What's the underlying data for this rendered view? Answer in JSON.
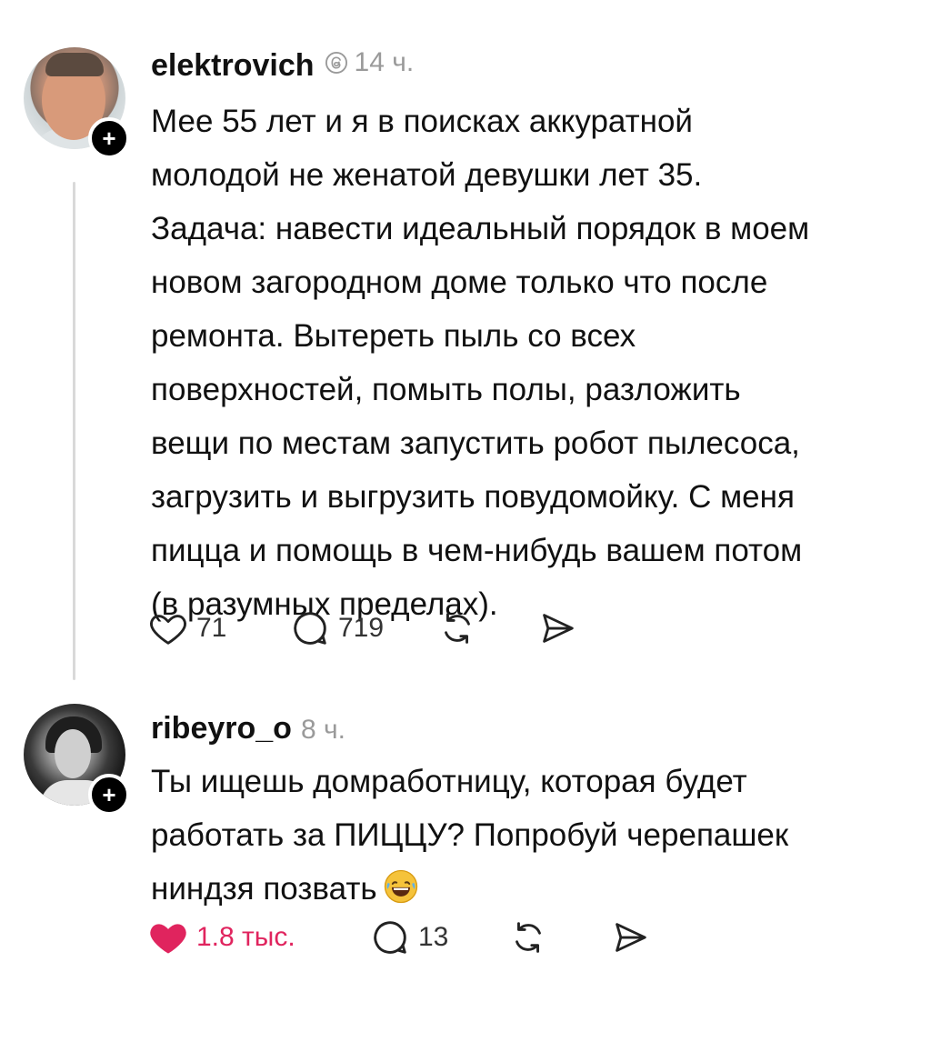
{
  "posts": [
    {
      "username": "elektrovich",
      "time": "14 ч.",
      "text": "Мее 55 лет и я в поисках аккуратной\nмолодой не женатой девушки лет 35.\nЗадача: навести идеальный порядок в моем\nновом загородном доме только что после\nремонта. Вытереть пыль со всех\nповерхностей, помыть полы, разложить\nвещи по местам запустить робот пылесоса,\nзагрузить и выгрузить повудомойку. С меня\nпицца и помощь в чем-нибудь вашем потом\n(в разумных пределах).",
      "likes": "71",
      "replies": "719",
      "liked": false
    },
    {
      "username": "ribeyro_o",
      "time": "8 ч.",
      "text": "Ты ищешь домработницу, которая будет\nработать за ПИЦЦУ? Попробуй черепашек\nниндзя позвать",
      "emoji": "😂",
      "likes": "1.8 тыс.",
      "replies": "13",
      "liked": true
    }
  ],
  "colors": {
    "text": "#111111",
    "muted": "#9a9a9a",
    "like_active": "#e0245e"
  },
  "icons": [
    "heart-icon",
    "comment-icon",
    "repost-icon",
    "share-icon",
    "follow-plus-icon",
    "threads-icon"
  ]
}
